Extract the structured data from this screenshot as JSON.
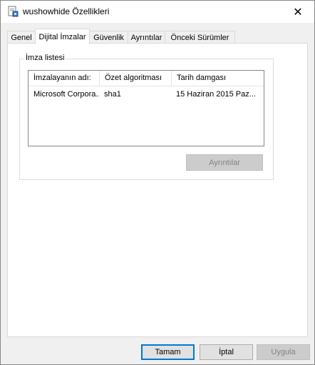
{
  "window": {
    "title": "wushowhide Özellikleri",
    "close_glyph": "✕"
  },
  "tabs": [
    {
      "label": "Genel",
      "active": false
    },
    {
      "label": "Dijital İmzalar",
      "active": true
    },
    {
      "label": "Güvenlik",
      "active": false
    },
    {
      "label": "Ayrıntılar",
      "active": false
    },
    {
      "label": "Önceki Sürümler",
      "active": false
    }
  ],
  "signature_list": {
    "group_label": "İmza listesi",
    "columns": [
      "İmzalayanın adı:",
      "Özet algoritması",
      "Tarih damgası"
    ],
    "rows": [
      [
        "Microsoft Corpora...",
        "sha1",
        "15 Haziran 2015 Paz..."
      ]
    ],
    "details_button": "Ayrıntılar"
  },
  "footer": {
    "ok": "Tamam",
    "cancel": "İptal",
    "apply": "Uygula"
  },
  "colors": {
    "accent": "#0078d7",
    "panel": "#ffffff",
    "background": "#f0f0f0"
  }
}
